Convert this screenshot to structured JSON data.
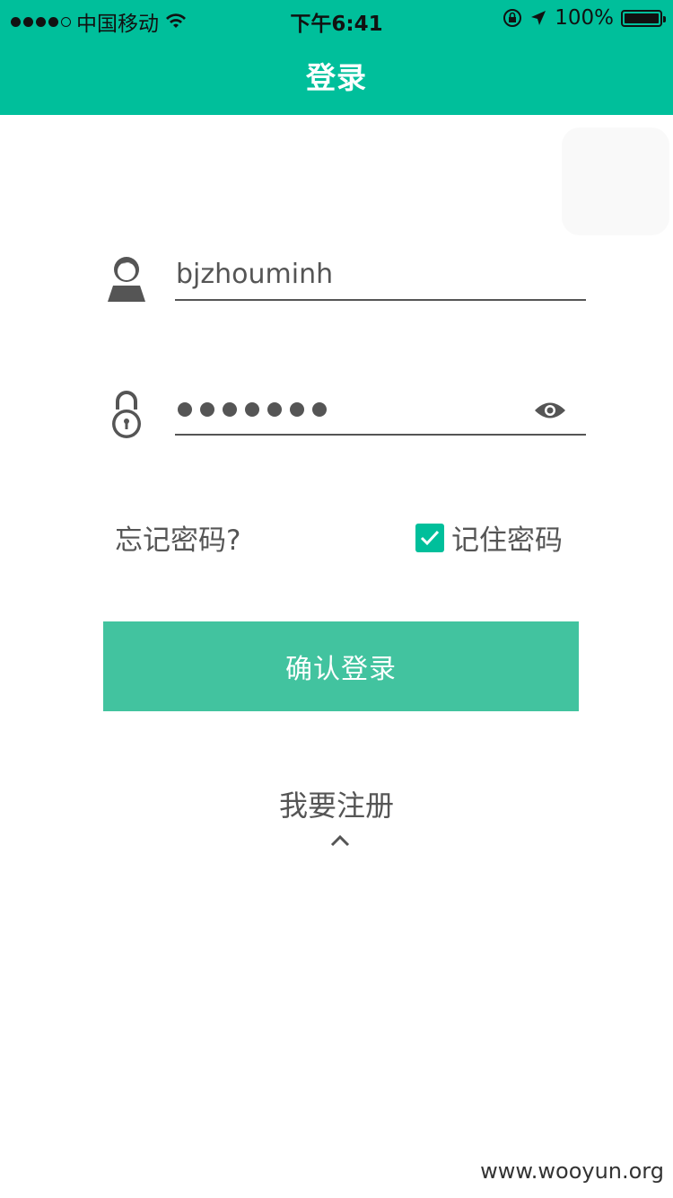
{
  "status_bar": {
    "carrier": "中国移动",
    "time": "下午6:41",
    "battery_text": "100%"
  },
  "header": {
    "title": "登录"
  },
  "form": {
    "username_value": "bjzhouminh",
    "password_mask": "•••••••",
    "forgot_label": "忘记密码?",
    "remember_label": "记住密码",
    "remember_checked": true
  },
  "actions": {
    "confirm_label": "确认登录",
    "register_label": "我要注册"
  },
  "watermark": "www.wooyun.org",
  "colors": {
    "brand": "#00bf9b",
    "button": "#42c39f",
    "text": "#555555"
  }
}
